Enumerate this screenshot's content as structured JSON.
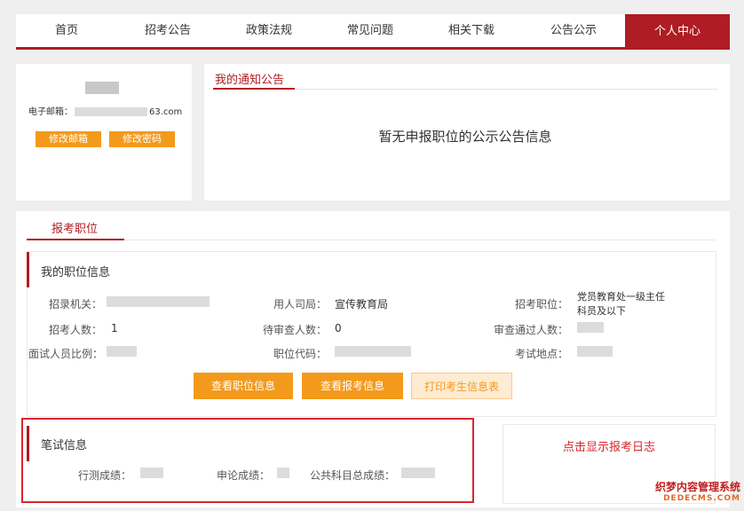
{
  "nav": {
    "items": [
      "首页",
      "招考公告",
      "政策法规",
      "常见问题",
      "相关下载",
      "公告公示",
      "个人中心"
    ],
    "active": "个人中心"
  },
  "profile": {
    "email_label": "电子邮箱：",
    "email_suffix": "63.com",
    "edit_email": "修改邮箱",
    "edit_password": "修改密码"
  },
  "notice": {
    "title": "我的通知公告",
    "empty_text": "暂无申报职位的公示公告信息"
  },
  "tab": {
    "label": "报考职位"
  },
  "job_info": {
    "title": "我的职位信息",
    "recruit_org_label": "招录机关：",
    "employer_label": "用人司局：",
    "employer_value": "宣传教育局",
    "position_label": "招考职位：",
    "position_value_line1": "党员教育处一级主任",
    "position_value_line2": "科员及以下",
    "recruit_count_label": "招考人数：",
    "recruit_count_value": "1",
    "pending_label": "待审查人数：",
    "pending_value": "0",
    "approved_label": "审查通过人数：",
    "interview_ratio_label": "面试人员比例：",
    "position_code_label": "职位代码：",
    "exam_location_label": "考试地点：",
    "btn_view_position": "查看职位信息",
    "btn_view_application": "查看报考信息",
    "btn_print": "打印考生信息表"
  },
  "exam": {
    "title": "笔试信息",
    "aptitude_label": "行测成绩：",
    "essay_label": "申论成绩：",
    "total_label": "公共科目总成绩："
  },
  "log": {
    "link": "点击显示报考日志"
  },
  "watermark": {
    "line1": "织梦内容管理系统",
    "line2": "DEDECMS.COM"
  },
  "colors": {
    "brand_red": "#b01c23",
    "orange": "#f39a1c"
  }
}
